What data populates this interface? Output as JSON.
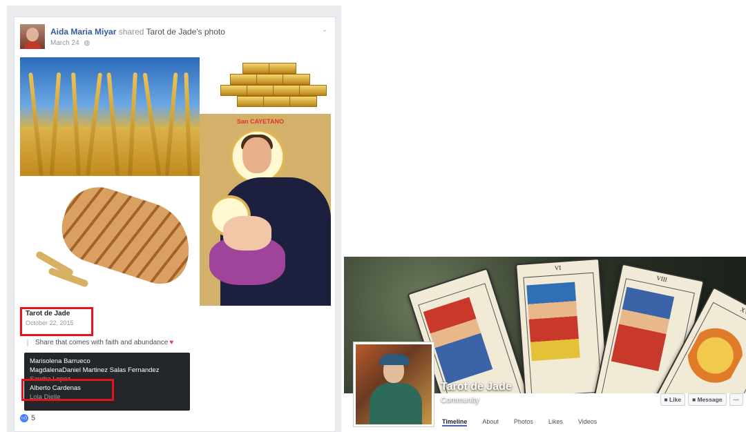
{
  "post": {
    "author": "Aida Maria Miyar",
    "shared_text": "shared",
    "shared_target": "Tarot de Jade's photo",
    "date": "March 24",
    "images": {
      "saint_title": "San CAYETANO"
    },
    "original_page_name": "Tarot de Jade",
    "original_date": "October 22, 2015",
    "quote": "Share that comes with faith and abundance",
    "tooltip_names": [
      "Marisolena Barrueco",
      "MagdalenaDaniel Martinez Salas Fernandez",
      "Sandra Lopez",
      "Alberto Cardenas",
      "Lola Dielle"
    ],
    "reaction_count": "5"
  },
  "page": {
    "title": "Tarot de Jade",
    "category": "Community",
    "like_button": "Like",
    "message_button": "Message",
    "more_button": "···",
    "cards": [
      "VI",
      "VIII",
      "XVIII"
    ],
    "tabs": [
      "Timeline",
      "About",
      "Photos",
      "Likes",
      "Videos"
    ]
  }
}
